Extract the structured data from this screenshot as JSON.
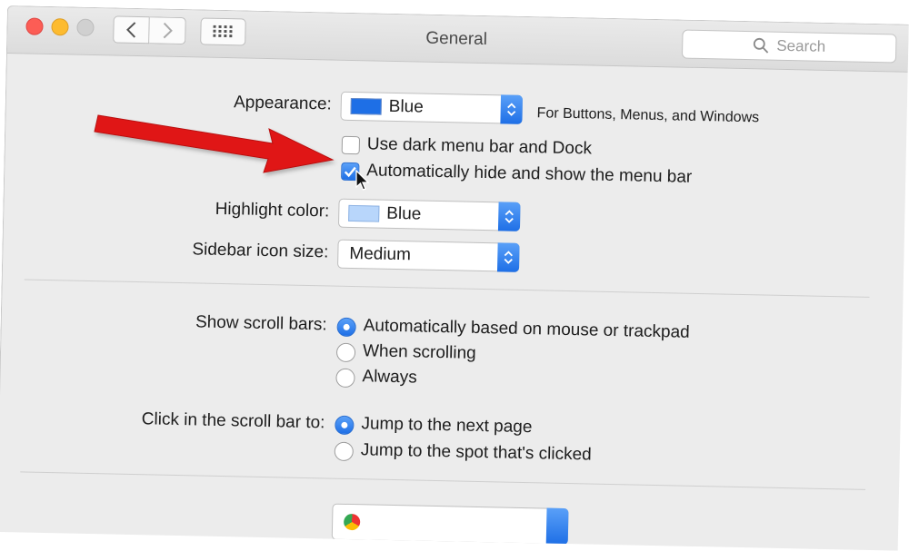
{
  "window": {
    "title": "General"
  },
  "search": {
    "placeholder": "Search"
  },
  "appearance": {
    "label": "Appearance:",
    "value": "Blue",
    "note": "For Buttons, Menus, and Windows",
    "swatch_color": "#1e6fe6"
  },
  "checkboxes": {
    "dark_menu": {
      "label": "Use dark menu bar and Dock",
      "checked": false
    },
    "auto_hide": {
      "label": "Automatically hide and show the menu bar",
      "checked": true
    }
  },
  "highlight": {
    "label": "Highlight color:",
    "value": "Blue",
    "swatch_color": "#b8d6fb"
  },
  "sidebar_icon": {
    "label": "Sidebar icon size:",
    "value": "Medium"
  },
  "scroll_bars": {
    "label": "Show scroll bars:",
    "options": [
      {
        "label": "Automatically based on mouse or trackpad",
        "selected": true
      },
      {
        "label": "When scrolling",
        "selected": false
      },
      {
        "label": "Always",
        "selected": false
      }
    ]
  },
  "click_scroll": {
    "label": "Click in the scroll bar to:",
    "options": [
      {
        "label": "Jump to the next page",
        "selected": true
      },
      {
        "label": "Jump to the spot that's clicked",
        "selected": false
      }
    ]
  },
  "colors": {
    "accent": "#1e6fe6",
    "annotation_arrow": "#e01818"
  }
}
